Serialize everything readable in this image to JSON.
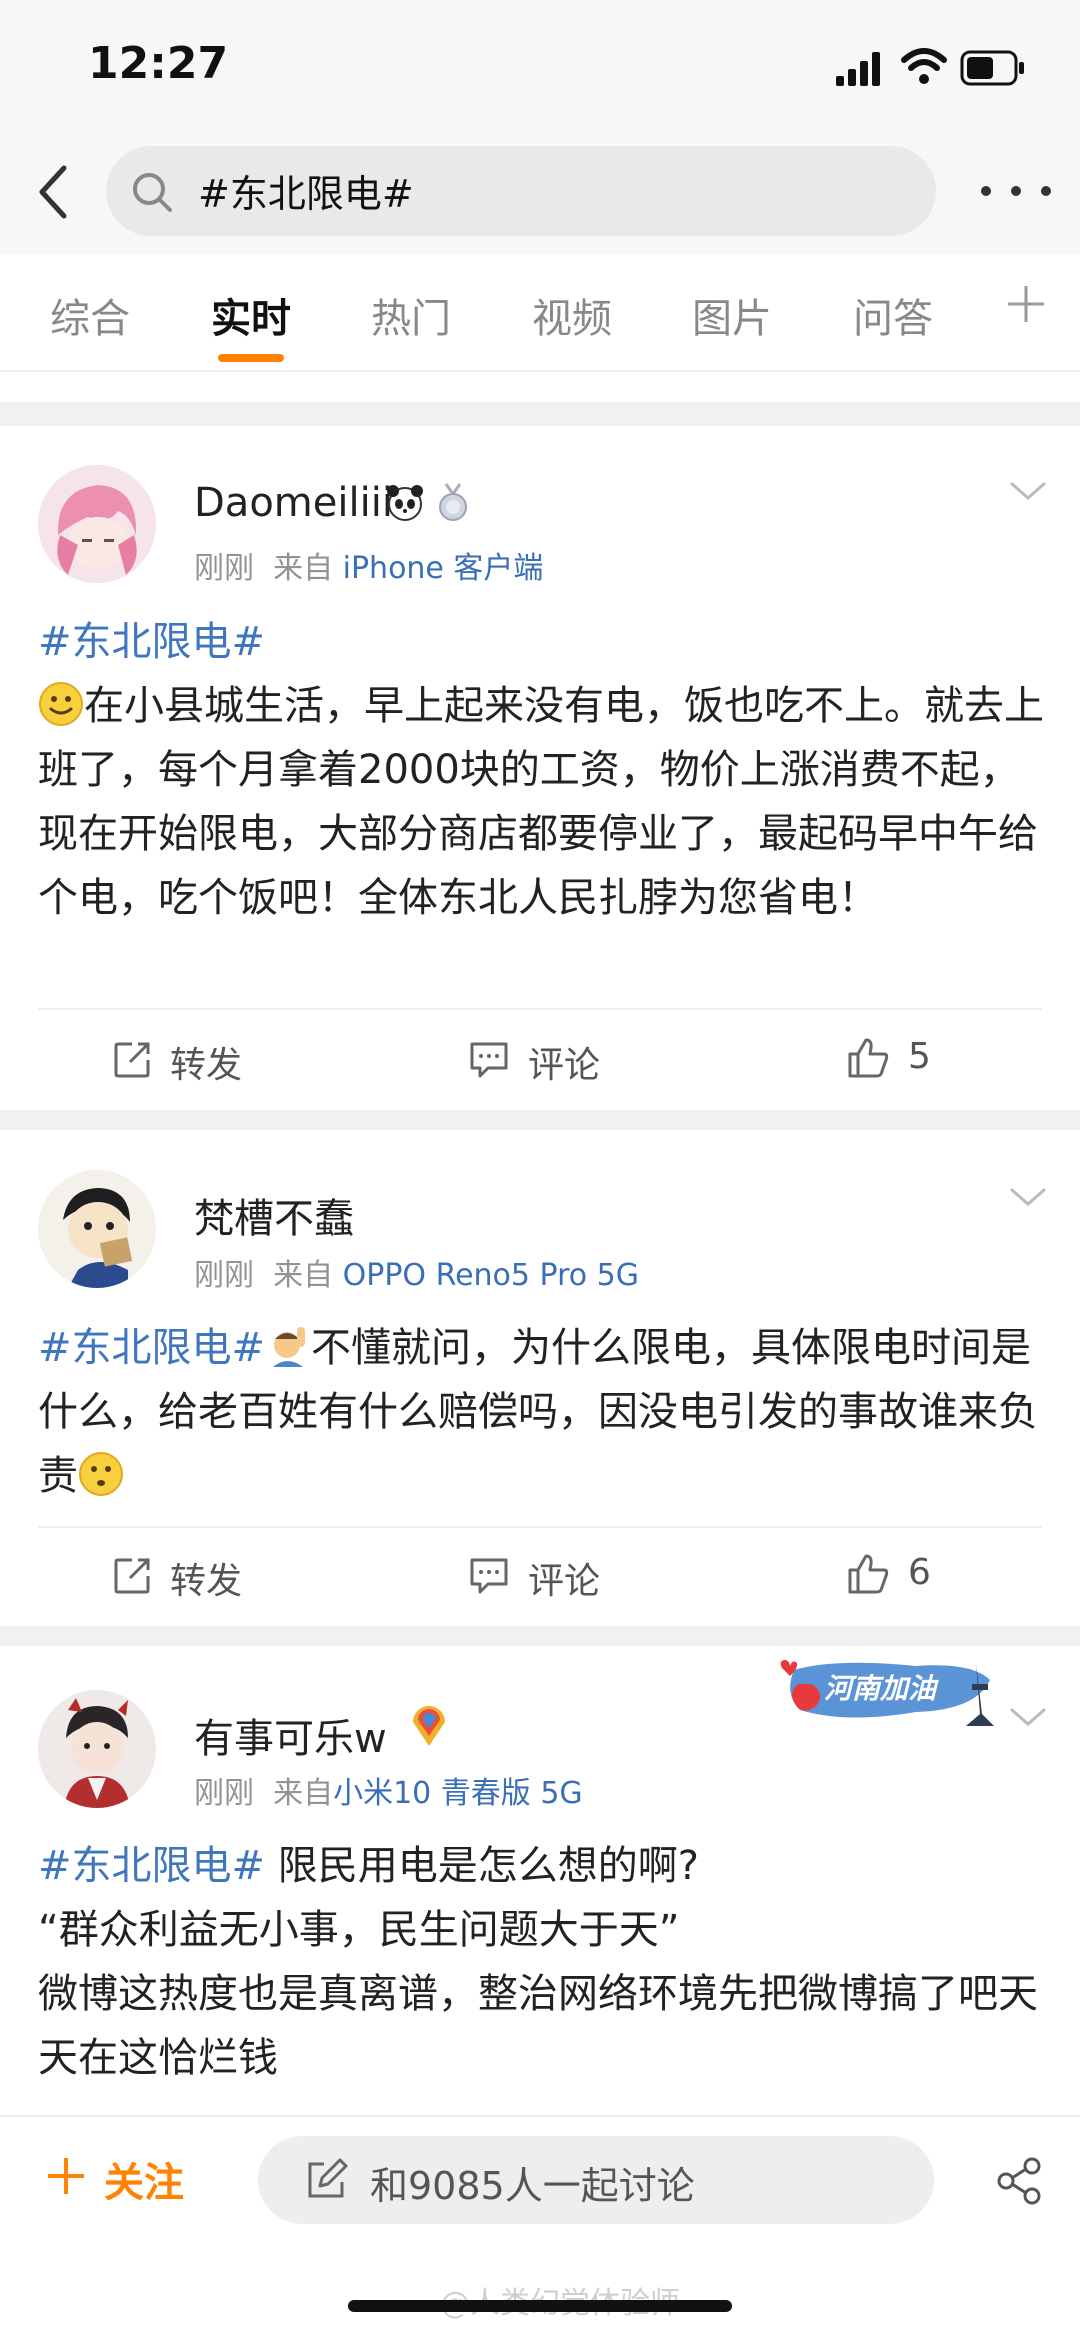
{
  "status": {
    "time": "12:27"
  },
  "search": {
    "query": "#东北限电#"
  },
  "tabs": [
    "综合",
    "实时",
    "热门",
    "视频",
    "图片",
    "问答"
  ],
  "posts": [
    {
      "username": "Daomeiliii",
      "time": "刚刚",
      "from": "来自",
      "source": "iPhone 客户端",
      "topic": "#东北限电#",
      "text": "在小县城生活，早上起来没有电，饭也吃不上。就去上班了，每个月拿着2000块的工资，物价上涨消费不起，现在开始限电，大部分商店都要停业了，最起码早中午给个电，吃个饭吧！全体东北人民扎脖为您省电！",
      "repost": "转发",
      "comment": "评论",
      "likes": "5"
    },
    {
      "username": "梵槽不蠢",
      "time": "刚刚",
      "from": "来自",
      "source": "OPPO Reno5 Pro 5G",
      "topic": "#东北限电#",
      "text": "不懂就问，为什么限电，具体限电时间是什么，给老百姓有什么赔偿吗，因没电引发的事故谁来负责",
      "repost": "转发",
      "comment": "评论",
      "likes": "6"
    },
    {
      "username": "有事可乐w",
      "time": "刚刚",
      "from": "来自",
      "source": "小米10 青春版 5G",
      "topic": "#东北限电#",
      "text_line1": "限民用电是怎么想的啊?",
      "text_line2": "“群众利益无小事，民生问题大于天”",
      "text_line3": "微博这热度也是真离谱，整治网络环境先把微博搞了吧天天在这恰烂钱",
      "badge": "河南加油"
    }
  ],
  "bottom": {
    "follow": "关注",
    "discuss": "和9085人一起讨论"
  },
  "watermark": "@人类幻觉体验师",
  "colors": {
    "accent": "#ff8200",
    "link": "#3f76bd"
  }
}
